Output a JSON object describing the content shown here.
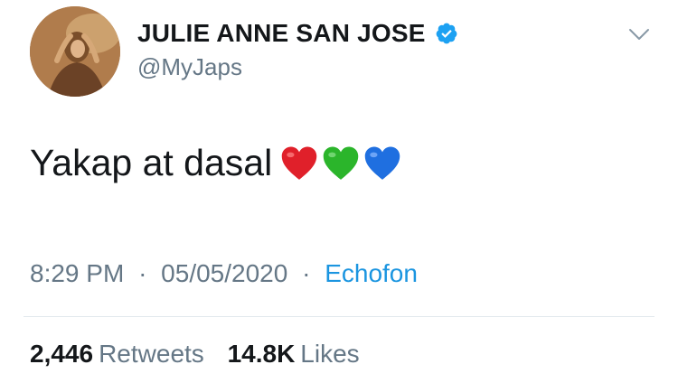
{
  "profile": {
    "display_name": "JULIE ANNE SAN JOSE",
    "handle": "@MyJaps",
    "verified": true,
    "accent_color": "#1da1f2"
  },
  "tweet": {
    "text": "Yakap at dasal",
    "emojis": [
      "red-heart",
      "green-heart",
      "blue-heart"
    ],
    "time": "8:29 PM",
    "date": "05/05/2020",
    "source": "Echofon",
    "separator": "·"
  },
  "stats": {
    "retweets_count": "2,446",
    "retweets_label": "Retweets",
    "likes_count": "14.8K",
    "likes_label": "Likes"
  },
  "icons": {
    "verified": "verified-badge-icon",
    "menu": "chevron-down-icon"
  }
}
